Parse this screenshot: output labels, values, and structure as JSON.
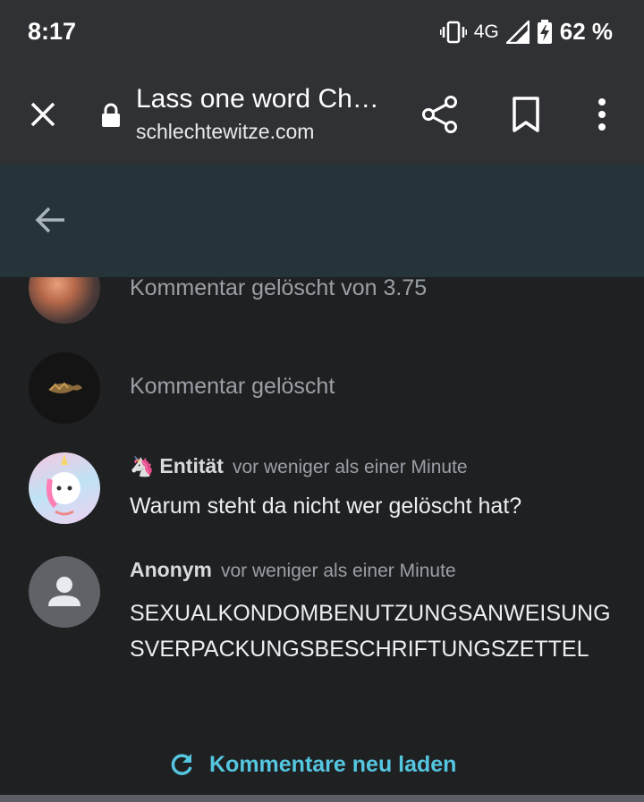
{
  "status_bar": {
    "time": "8:17",
    "network": "4G",
    "battery": "62 %",
    "icons": [
      "vibrate-icon",
      "signal-icon",
      "battery-charging-icon"
    ]
  },
  "browser_toolbar": {
    "title": "Lass one word Ch…",
    "domain": "schlechtewitze.com",
    "icons": [
      "close-icon",
      "lock-icon",
      "share-icon",
      "bookmark-icon",
      "more-vert-icon"
    ]
  },
  "page_header": {
    "icons": [
      "back-arrow-icon"
    ]
  },
  "comments": [
    {
      "deleted_text": "Kommentar gelöscht von 3.75"
    },
    {
      "deleted_text": "Kommentar gelöscht"
    },
    {
      "emoji": "🦄",
      "author": "Entität",
      "time": "vor weniger als einer Minute",
      "body": "Warum steht da nicht wer gelöscht hat?"
    },
    {
      "author": "Anonym",
      "time": "vor weniger als einer Minute",
      "body": "SEXUALKONDOMBENUTZUNGSANWEISUNGSVERPACKUNGSBESCHRIFTUNGSZETTEL"
    }
  ],
  "reload": {
    "label": "Kommentare neu laden"
  },
  "colors": {
    "accent": "#55c6e0",
    "header_bg": "#26343a",
    "toolbar_bg": "#303134",
    "page_bg": "#1f2022"
  }
}
